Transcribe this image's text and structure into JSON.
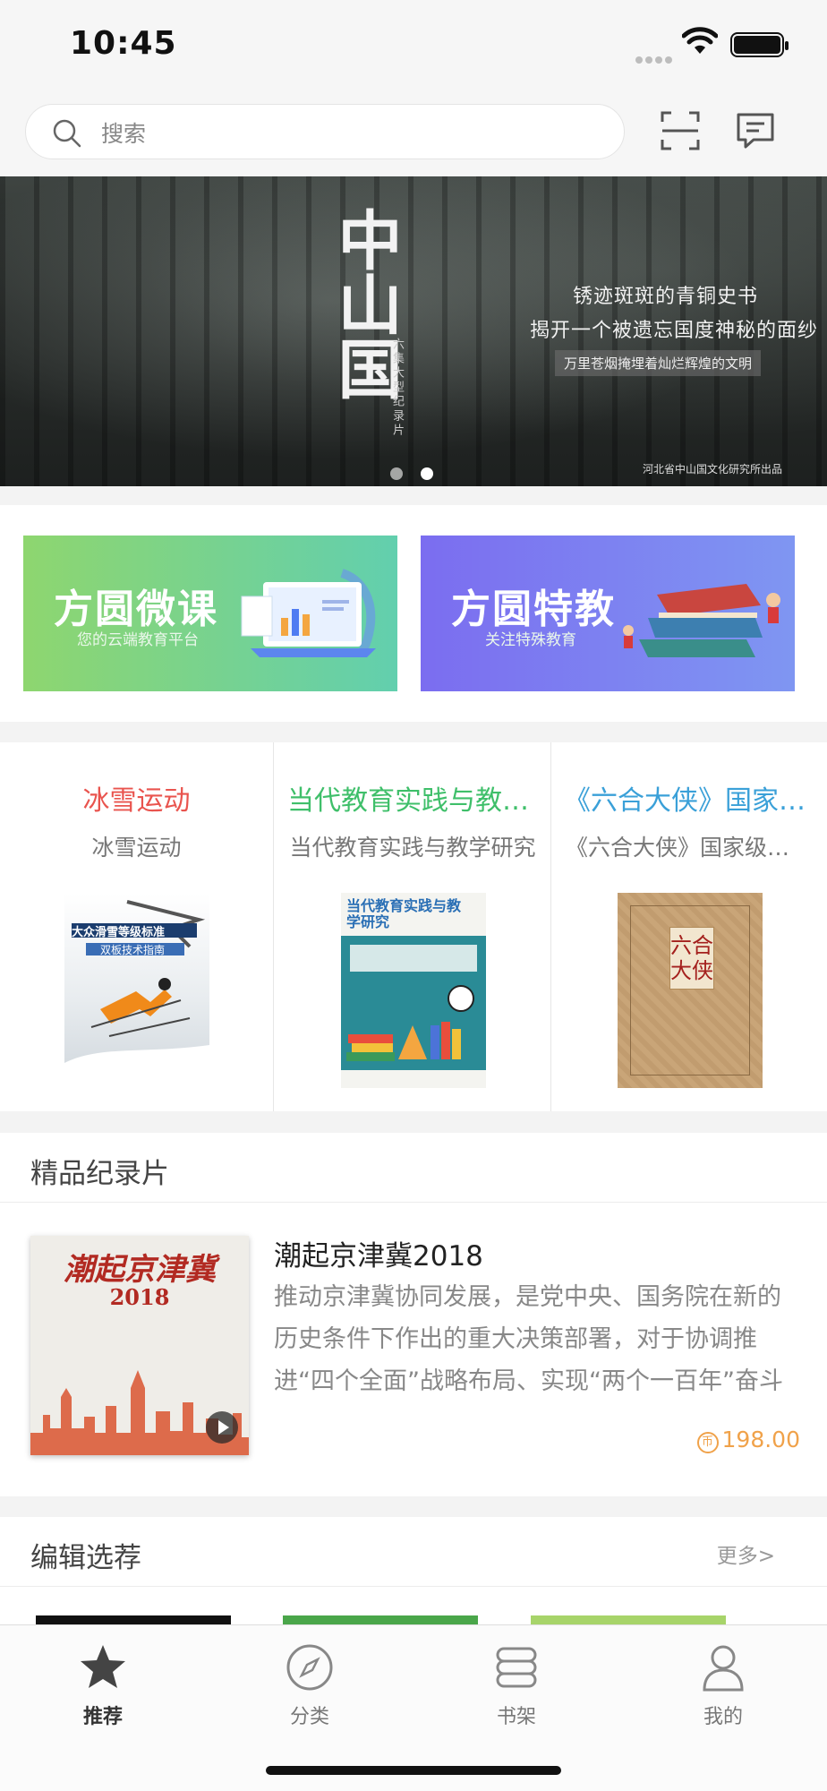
{
  "status_bar": {
    "time": "10:45"
  },
  "search": {
    "placeholder": "搜索"
  },
  "banner": {
    "title": "中山国",
    "subtitle": "六集大型纪录片",
    "line1": "锈迹斑斑的青铜史书",
    "line2": "揭开一个被遗忘国度神秘的面纱",
    "line3": "万里苍烟掩埋着灿烂辉煌的文明",
    "footer": "河北省中山国文化研究所出品",
    "pages": 2,
    "active_page": 2
  },
  "promos": [
    {
      "title": "方圆微课",
      "subtitle": "您的云端教育平台"
    },
    {
      "title": "方圆特教",
      "subtitle": "关注特殊教育"
    }
  ],
  "featured_books": [
    {
      "title": "冰雪运动",
      "subtitle": "冰雪运动",
      "color": "#e9544e",
      "cover_text": "大众滑雪等级标准",
      "cover_sub": "双板技术指南"
    },
    {
      "title": "当代教育实践与教学研究",
      "subtitle": "当代教育实践与教学研究",
      "color": "#3fbf6a",
      "cover_text": "当代教育实践与教学研究"
    },
    {
      "title": "《六合大侠》国家级非物质文化遗产",
      "subtitle": "《六合大侠》国家级非物质文化遗产",
      "color": "#3aa0d8",
      "cover_text": "六合大侠"
    }
  ],
  "documentary": {
    "section_title": "精品纪录片",
    "item": {
      "title": "潮起京津冀2018",
      "description": "推动京津冀协同发展，是党中央、国务院在新的历史条件下作出的重大决策部署，对于协调推进“四个全面”战略布局、实现“两个一百年”奋斗目标具有重大现实意义和深远历史意义。",
      "cover_text": "潮起京津冀",
      "cover_year": "2018",
      "price": "198.00",
      "coin_glyph": "币"
    }
  },
  "editor_picks": {
    "section_title": "编辑选荐",
    "more_label": "更多>"
  },
  "tabs": [
    {
      "label": "推荐",
      "icon": "star-icon",
      "active": true
    },
    {
      "label": "分类",
      "icon": "compass-icon",
      "active": false
    },
    {
      "label": "书架",
      "icon": "bookshelf-icon",
      "active": false
    },
    {
      "label": "我的",
      "icon": "profile-icon",
      "active": false
    }
  ],
  "colors": {
    "accent_price": "#f0a24a",
    "tab_active": "#333333"
  }
}
